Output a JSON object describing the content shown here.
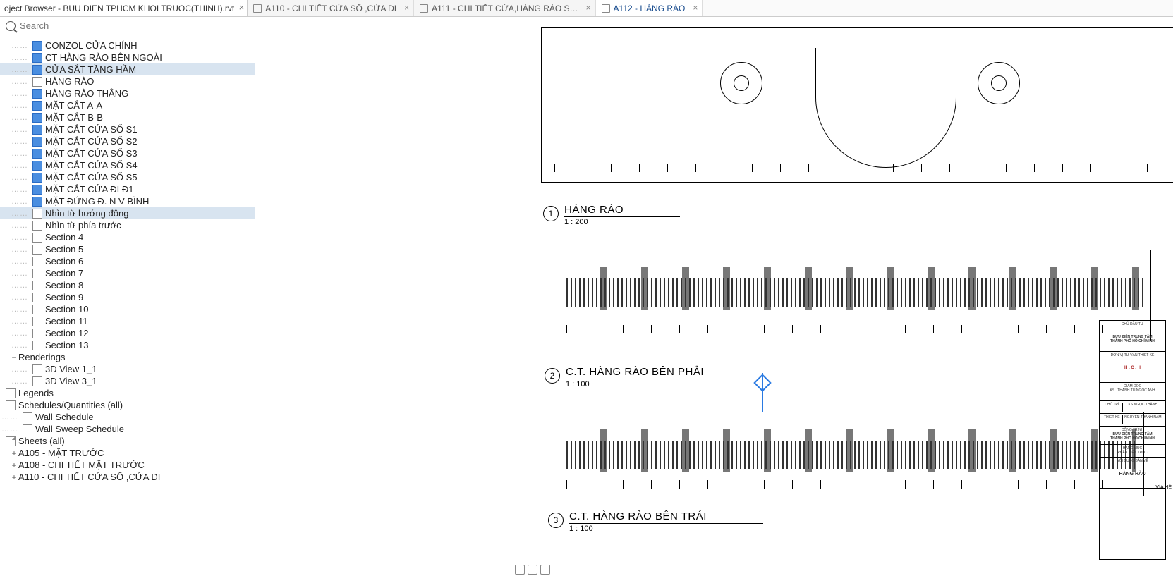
{
  "panelTitle": "oject Browser - BUU DIEN TPHCM KHOI TRUOC(THINH).rvt",
  "searchPlaceholder": "Search",
  "tabs": [
    {
      "label": "A110 - CHI TIẾT  CỬA SỔ ,CỬA ĐI",
      "active": false
    },
    {
      "label": "A111 - CHI TIẾT CỬA,HÀNG RÀO S…",
      "active": false
    },
    {
      "label": "A112 - HÀNG RÀO",
      "active": true
    }
  ],
  "treeItemsA": [
    {
      "t": "CONZOL CỬA CHÍNH",
      "f": true
    },
    {
      "t": "CT HÀNG RÀO BÊN NGOÀI",
      "f": true
    },
    {
      "t": "CỬA SẮT TẦNG HẦM",
      "f": true,
      "hi": true
    },
    {
      "t": "HÀNG RÀO",
      "f": false
    },
    {
      "t": "HÀNG RÀO THẲNG",
      "f": true
    },
    {
      "t": "MẶT CẮT A-A",
      "f": true
    },
    {
      "t": "MẶT CẮT B-B",
      "f": true
    },
    {
      "t": "MẶT CẮT CỬA SỔ S1",
      "f": true
    },
    {
      "t": "MẶT CẮT CỬA SỔ S2",
      "f": true
    },
    {
      "t": "MẶT CẮT CỬA SỔ S3",
      "f": true
    },
    {
      "t": "MẶT CẮT CỬA SỔ S4",
      "f": true
    },
    {
      "t": "MẶT CẮT CỬA SỔ S5",
      "f": true
    },
    {
      "t": "MẶT CẮT CỬA ĐI Đ1",
      "f": true
    },
    {
      "t": "MẶT ĐỨNG Đ. N V BÌNH",
      "f": true
    },
    {
      "t": "Nhìn từ hướng đông",
      "f": false,
      "hi": true
    },
    {
      "t": "Nhìn từ phía trước",
      "f": false
    },
    {
      "t": "Section 4",
      "f": false
    },
    {
      "t": "Section 5",
      "f": false
    },
    {
      "t": "Section 6",
      "f": false
    },
    {
      "t": "Section 7",
      "f": false
    },
    {
      "t": "Section 8",
      "f": false
    },
    {
      "t": "Section 9",
      "f": false
    },
    {
      "t": "Section 10",
      "f": false
    },
    {
      "t": "Section 11",
      "f": false
    },
    {
      "t": "Section 12",
      "f": false
    },
    {
      "t": "Section 13",
      "f": false
    }
  ],
  "renderingsLabel": "Renderings",
  "renderings": [
    "3D View 1_1",
    "3D View 3_1"
  ],
  "legendsLabel": "Legends",
  "schedulesLabel": "Schedules/Quantities (all)",
  "schedules": [
    "Wall Schedule",
    "Wall Sweep Schedule"
  ],
  "sheetsLabel": "Sheets (all)",
  "sheets": [
    "A105 - MẶT TRƯỚC",
    "A108 - CHI TIẾT MẶT TRƯỚC",
    "A110 - CHI TIẾT CỬA SỔ ,CỬA ĐI"
  ],
  "captions": [
    {
      "n": "1",
      "title": "HÀNG RÀO",
      "scale": "1 : 200"
    },
    {
      "n": "2",
      "title": "C.T.  HÀNG RÀO BÊN PHẢI",
      "scale": "1 : 100"
    },
    {
      "n": "3",
      "title": "C.T.  HÀNG RÀO BÊN TRÁI",
      "scale": "1 : 100"
    }
  ],
  "titleBlock": {
    "owner": "CHỦ ĐẦU TƯ",
    "proj": "BƯU ĐIỆN TRUNG TÂM\nTHÀNH PHỐ HỒ CHÍ MINH",
    "consultant": "ĐƠN VỊ TƯ VẤN THIẾT KẾ",
    "company": "H . C . H",
    "giamdoc": "GIÁM ĐỐC",
    "ks": "KS . THANH TÙ NGỌC ANH",
    "chutri": "CHỦ TRÌ",
    "chutriVal": "KS NGỌC THÀNH",
    "thietke": "THIẾT KẾ",
    "thietkeVal": "NGUYỄN THÀNH NAM",
    "congtrinh": "CÔNG TRÌNH",
    "congtrinhVal": "BƯU ĐIỆN TRUNG TÂM\nTHÀNH PHỐ HỒ CHÍ MINH",
    "hangmuc": "HẠNG MỤC",
    "hangmucVal": "PHẦN KIẾN TRÚC",
    "noidung": "NỘI DUNG BẢN VẼ",
    "banve": "HÀNG RÀO"
  },
  "viaHe": "VỈA HÈ"
}
